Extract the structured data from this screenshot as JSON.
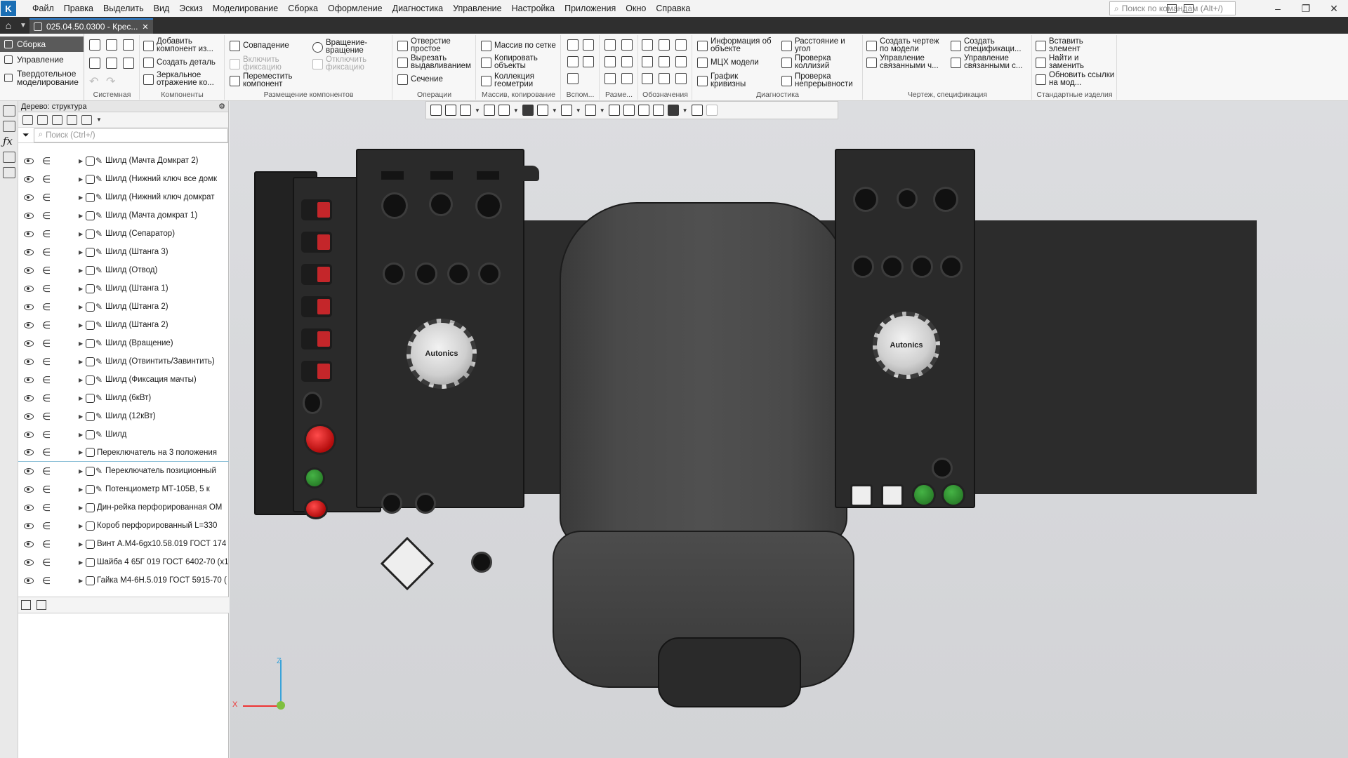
{
  "menubar": {
    "items": [
      "Файл",
      "Правка",
      "Выделить",
      "Вид",
      "Эскиз",
      "Моделирование",
      "Сборка",
      "Оформление",
      "Диагностика",
      "Управление",
      "Настройка",
      "Приложения",
      "Окно",
      "Справка"
    ],
    "search_placeholder": "Поиск по командам (Alt+/)"
  },
  "tabbar": {
    "doc_title": "025.04.50.0300 - Крес...",
    "close": "✕"
  },
  "ribbon": {
    "modes": [
      "Сборка",
      "Управление",
      "Твердотельное моделирование"
    ],
    "groups": {
      "system": "Системная",
      "components": "Компоненты",
      "placement": "Размещение компонентов",
      "operations": "Операции",
      "array": "Массив, копирование",
      "aux": "Вспом...",
      "dims": "Разме...",
      "notation": "Обозначения",
      "diagnostics": "Диагностика",
      "drawing": "Чертеж, спецификация",
      "standard": "Стандартные изделия"
    },
    "buttons": {
      "add_component": "Добавить компонент из...",
      "create_part": "Создать деталь",
      "mirror": "Зеркальное отражение ко...",
      "coincidence": "Совпадение",
      "enable_fix": "Включить фиксацию",
      "move_component": "Переместить компонент",
      "rotation": "Вращение-вращение",
      "disable_fix": "Отключить фиксацию",
      "hole_simple": "Отверстие простое",
      "cut_extrude": "Вырезать выдавливанием",
      "section": "Сечение",
      "grid_array": "Массив по сетке",
      "copy_objects": "Копировать объекты",
      "geom_collection": "Коллекция геометрии",
      "object_info": "Информация об объекте",
      "mass_props": "МЦХ модели",
      "curvature": "График кривизны",
      "dist_angle": "Расстояние и угол",
      "collision": "Проверка коллизий",
      "continuity": "Проверка непрерывности",
      "create_drawing": "Создать чертеж по модели",
      "manage_linked": "Управление связанными ч...",
      "create_spec": "Создать спецификаци...",
      "manage_linked_s": "Управление связанными с...",
      "insert_element": "Вставить элемент",
      "find_replace": "Найти и заменить",
      "update_links": "Обновить ссылки на мод..."
    }
  },
  "tree": {
    "title": "Дерево: структура",
    "search_placeholder": "Поиск (Ctrl+/)",
    "rows": [
      "Шилд (Мачта Домкрат 2)",
      "Шилд (Нижний ключ все домк",
      "Шилд (Нижний ключ домкрат",
      "Шилд (Мачта домкрат 1)",
      "Шилд (Сепаратор)",
      "Шилд (Штанга 3)",
      "Шилд (Отвод)",
      "Шилд (Штанга 1)",
      "Шилд (Штанга 2)",
      "Шилд (Штанга 2)",
      "Шилд (Вращение)",
      "Шилд (Отвинтить/Завинтить)",
      "Шилд (Фиксация мачты)",
      "Шилд (6кВт)",
      "Шилд (12кВт)",
      "Шилд",
      "Переключатель на 3 положения",
      "Переключатель позиционный",
      "Потенциометр МТ-105В, 5 к",
      "Дин-рейка перфорированная ОМ",
      "Короб перфорированный L=330",
      "Винт А.М4-6gx10.58.019 ГОСТ 174",
      "Шайба 4 65Г 019 ГОСТ 6402-70 (х1",
      "Гайка М4-6Н.5.019 ГОСТ 5915-70 ("
    ]
  },
  "viewport": {
    "dial_brand": "Autonics",
    "axis_x": "X",
    "axis_z": "Z"
  },
  "colors": {
    "accent": "#1b6fb5",
    "stop_red": "#c4262a",
    "lamp_green": "#2f8f2f"
  }
}
